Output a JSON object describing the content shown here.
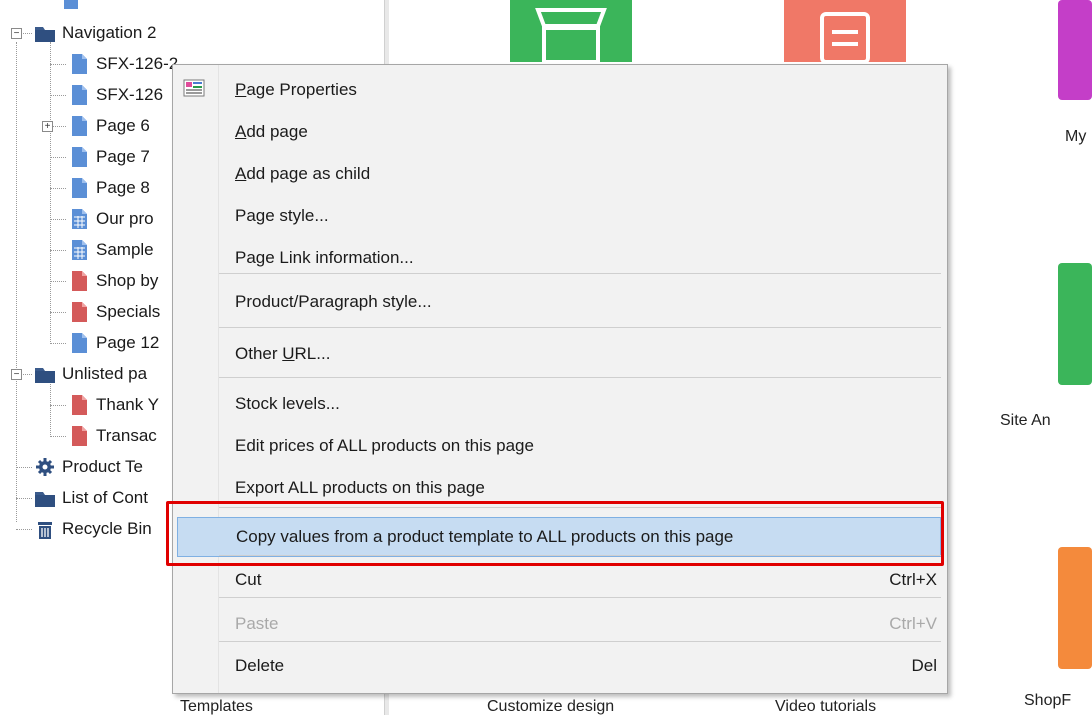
{
  "tree": {
    "items": [
      {
        "label": "Navigation 2",
        "type": "folder",
        "expander": "−"
      },
      {
        "label": "SFX-126-2",
        "type": "page-blue"
      },
      {
        "label": "SFX-126",
        "type": "page-blue"
      },
      {
        "label": "Page 6",
        "type": "page-blue",
        "expander": "+"
      },
      {
        "label": "Page 7",
        "type": "page-blue"
      },
      {
        "label": "Page 8",
        "type": "page-blue"
      },
      {
        "label": "Our pro",
        "type": "page-grid"
      },
      {
        "label": "Sample",
        "type": "page-grid"
      },
      {
        "label": "Shop by",
        "type": "page-red"
      },
      {
        "label": "Specials",
        "type": "page-red"
      },
      {
        "label": "Page 12",
        "type": "page-blue"
      },
      {
        "label": "Unlisted pa",
        "type": "folder",
        "expander": "−"
      },
      {
        "label": "Thank Y",
        "type": "page-red"
      },
      {
        "label": "Transac",
        "type": "page-red"
      },
      {
        "label": "Product Te",
        "type": "gear"
      },
      {
        "label": "List of Cont",
        "type": "folder"
      },
      {
        "label": "Recycle Bin",
        "type": "bin"
      }
    ]
  },
  "tiles": [
    {
      "caption": "",
      "color": "#3bb55a"
    },
    {
      "caption": "",
      "color": "#f07867"
    },
    {
      "caption": "My",
      "color": "#c43ec8"
    },
    {
      "caption": "Site An",
      "color": "#3bb55a"
    },
    {
      "caption": "ShopF",
      "color": "#f48a3c"
    }
  ],
  "bottom_captions": {
    "left": "Templates",
    "customize": "Customize design",
    "video": "Video tutorials"
  },
  "context_menu": {
    "items": [
      {
        "pre": "",
        "ul": "P",
        "post": "age Properties",
        "shortcut": ""
      },
      {
        "pre": "",
        "ul": "A",
        "post": "dd page",
        "shortcut": ""
      },
      {
        "pre": "",
        "ul": "A",
        "post": "dd page as child",
        "shortcut": ""
      },
      {
        "pre": "Page style...",
        "ul": "",
        "post": "",
        "shortcut": ""
      },
      {
        "pre": "Page Link information...",
        "ul": "",
        "post": "",
        "shortcut": ""
      },
      {
        "pre": "Product/Paragraph style...",
        "ul": "",
        "post": "",
        "shortcut": ""
      },
      {
        "pre": "Other ",
        "ul": "U",
        "post": "RL...",
        "shortcut": ""
      },
      {
        "pre": "Stock levels...",
        "ul": "",
        "post": "",
        "shortcut": ""
      },
      {
        "pre": "Edit prices of ALL products on this page",
        "ul": "",
        "post": "",
        "shortcut": ""
      },
      {
        "pre": "Export ALL products on this page",
        "ul": "",
        "post": "",
        "shortcut": ""
      },
      {
        "pre": "Copy values from a product template to ALL products on this page",
        "ul": "",
        "post": "",
        "shortcut": ""
      },
      {
        "pre": "Cut",
        "ul": "",
        "post": "",
        "shortcut": "Ctrl+X"
      },
      {
        "pre": "Paste",
        "ul": "",
        "post": "",
        "shortcut": "Ctrl+V"
      },
      {
        "pre": "Delete",
        "ul": "",
        "post": "",
        "shortcut": "Del"
      }
    ]
  },
  "colors": {
    "highlight": "#c6dcf2",
    "annotation": "#e00000",
    "folder": "#3b5b8c",
    "page_blue": "#5b8fd6",
    "page_red": "#d45a5a"
  }
}
